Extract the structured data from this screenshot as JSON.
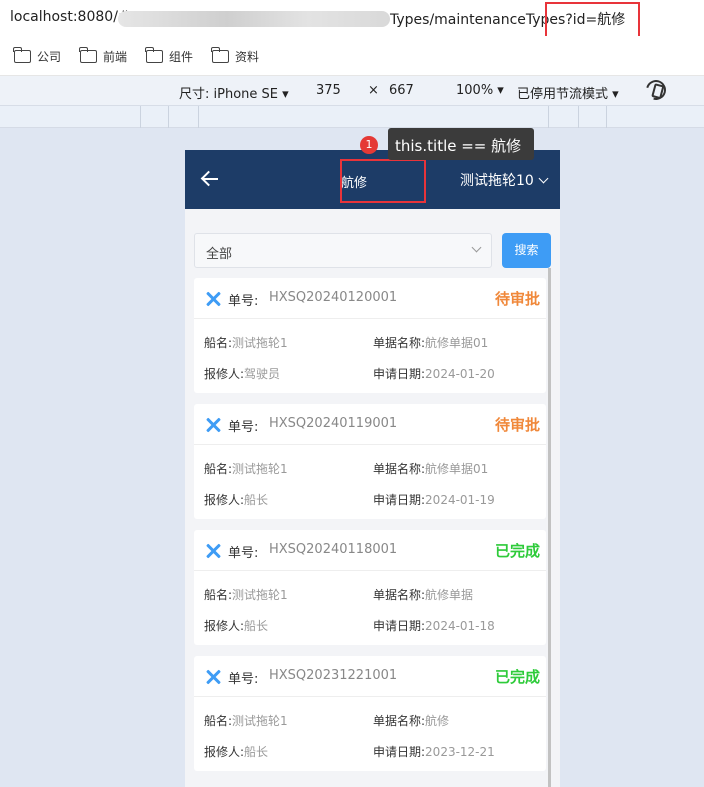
{
  "browser": {
    "url_prefix": "localhost:8080/#",
    "url_suffix": "Types/maintenanceTypes?id=航修",
    "bookmarks": [
      "公司",
      "前端",
      "组件",
      "资料"
    ]
  },
  "device_toolbar": {
    "size_label": "尺寸: iPhone SE",
    "width": "375",
    "times": "×",
    "height": "667",
    "zoom": "100%",
    "throttle": "已停用节流模式"
  },
  "tooltip": {
    "badge": "1",
    "text": "this.title == 航修"
  },
  "app": {
    "title": "航修",
    "vessel": "测试拖轮10",
    "filter_value": "全部",
    "search_label": "搜索",
    "labels": {
      "order": "单号:",
      "ship": "船名:",
      "doc_name": "单据名称:",
      "reporter": "报修人:",
      "apply_date": "申请日期:"
    },
    "records": [
      {
        "order_no": "HXSQ20240120001",
        "status": "待审批",
        "ship": "测试拖轮1",
        "doc_name": "航修单据01",
        "reporter": "驾驶员",
        "date": "2024-01-20"
      },
      {
        "order_no": "HXSQ20240119001",
        "status": "待审批",
        "ship": "测试拖轮1",
        "doc_name": "航修单据01",
        "reporter": "船长",
        "date": "2024-01-19"
      },
      {
        "order_no": "HXSQ20240118001",
        "status": "已完成",
        "ship": "测试拖轮1",
        "doc_name": "航修单据",
        "reporter": "船长",
        "date": "2024-01-18"
      },
      {
        "order_no": "HXSQ20231221001",
        "status": "已完成",
        "ship": "测试拖轮1",
        "doc_name": "航修",
        "reporter": "船长",
        "date": "2023-12-21"
      }
    ]
  },
  "colors": {
    "header_bg": "#1d3c67",
    "accent": "#3e9cf5",
    "status_pending": "#f0883a",
    "status_done": "#2ecb3a",
    "highlight": "#e8343a"
  }
}
